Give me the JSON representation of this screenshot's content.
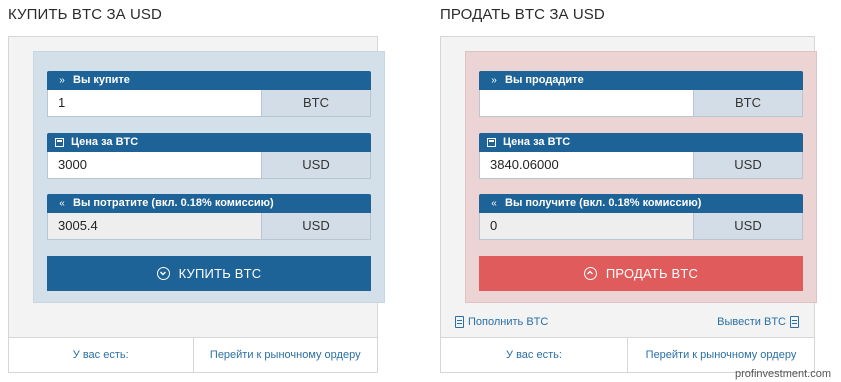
{
  "buy": {
    "title": "КУПИТЬ BTC ЗА USD",
    "amount_label": "Вы купите",
    "amount_value": "1",
    "amount_currency": "BTC",
    "price_label": "Цена за BTC",
    "price_value": "3000",
    "price_currency": "USD",
    "total_label": "Вы потратите (вкл. 0.18% комиссию)",
    "total_value": "3005.4",
    "total_currency": "USD",
    "button_label": "КУПИТЬ BTC",
    "footer_left": "У вас есть:",
    "footer_right": "Перейти к рыночному ордеру"
  },
  "sell": {
    "title": "ПРОДАТЬ BTC ЗА USD",
    "amount_label": "Вы продадите",
    "amount_value": "",
    "amount_currency": "BTC",
    "price_label": "Цена за BTC",
    "price_value": "3840.06000",
    "price_currency": "USD",
    "total_label": "Вы получите (вкл. 0.18% комиссию)",
    "total_value": "0",
    "total_currency": "USD",
    "button_label": "ПРОДАТЬ BTC",
    "deposit_link": "Пополнить BTC",
    "withdraw_link": "Вывести BTC",
    "footer_left": "У вас есть:",
    "footer_right": "Перейти к рыночному ордеру"
  },
  "watermark": "profinvestment.com",
  "colors": {
    "primary": "#1e6398",
    "sell_button": "#e05c5c",
    "buy_box": "#d3dfe9",
    "sell_box": "#ecd3d4",
    "link": "#2a6fa6"
  }
}
